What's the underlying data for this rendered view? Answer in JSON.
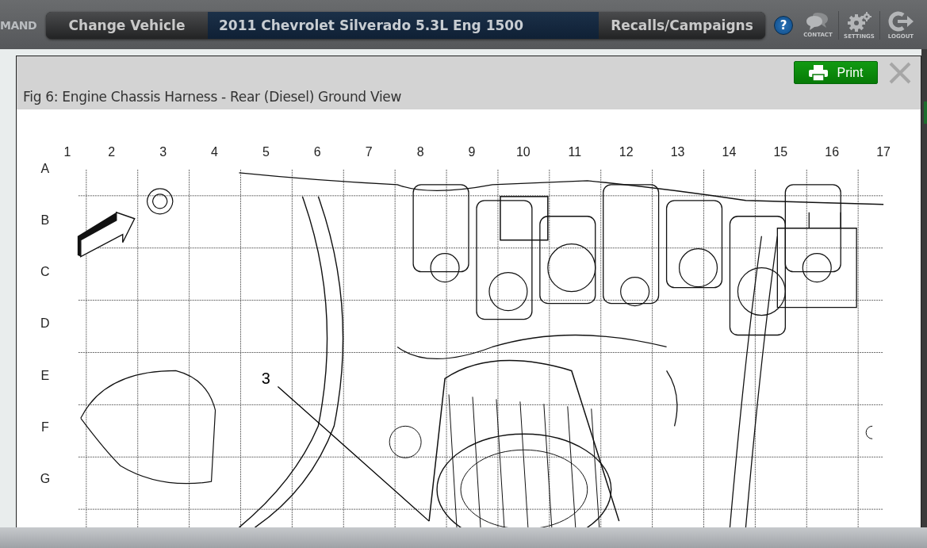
{
  "top_bar": {
    "brand_fragment": "MAND",
    "change_vehicle": "Change Vehicle",
    "vehicle": "2011 Chevrolet Silverado 5.3L Eng 1500",
    "recalls": "Recalls/Campaigns",
    "help": "?",
    "actions": [
      {
        "kind": "contact",
        "label": "CONTACT"
      },
      {
        "kind": "settings",
        "label": "SETTINGS"
      },
      {
        "kind": "logout",
        "label": "LOGOUT"
      }
    ]
  },
  "dialog": {
    "print": "Print",
    "title": "Fig 6: Engine Chassis Harness - Rear (Diesel) Ground View",
    "figure": {
      "column_labels": [
        "1",
        "2",
        "3",
        "4",
        "5",
        "6",
        "7",
        "8",
        "9",
        "10",
        "11",
        "12",
        "13",
        "14",
        "15",
        "16",
        "17"
      ],
      "row_labels": [
        "A",
        "B",
        "C",
        "D",
        "E",
        "F",
        "G"
      ],
      "callouts": [
        "3"
      ]
    }
  }
}
